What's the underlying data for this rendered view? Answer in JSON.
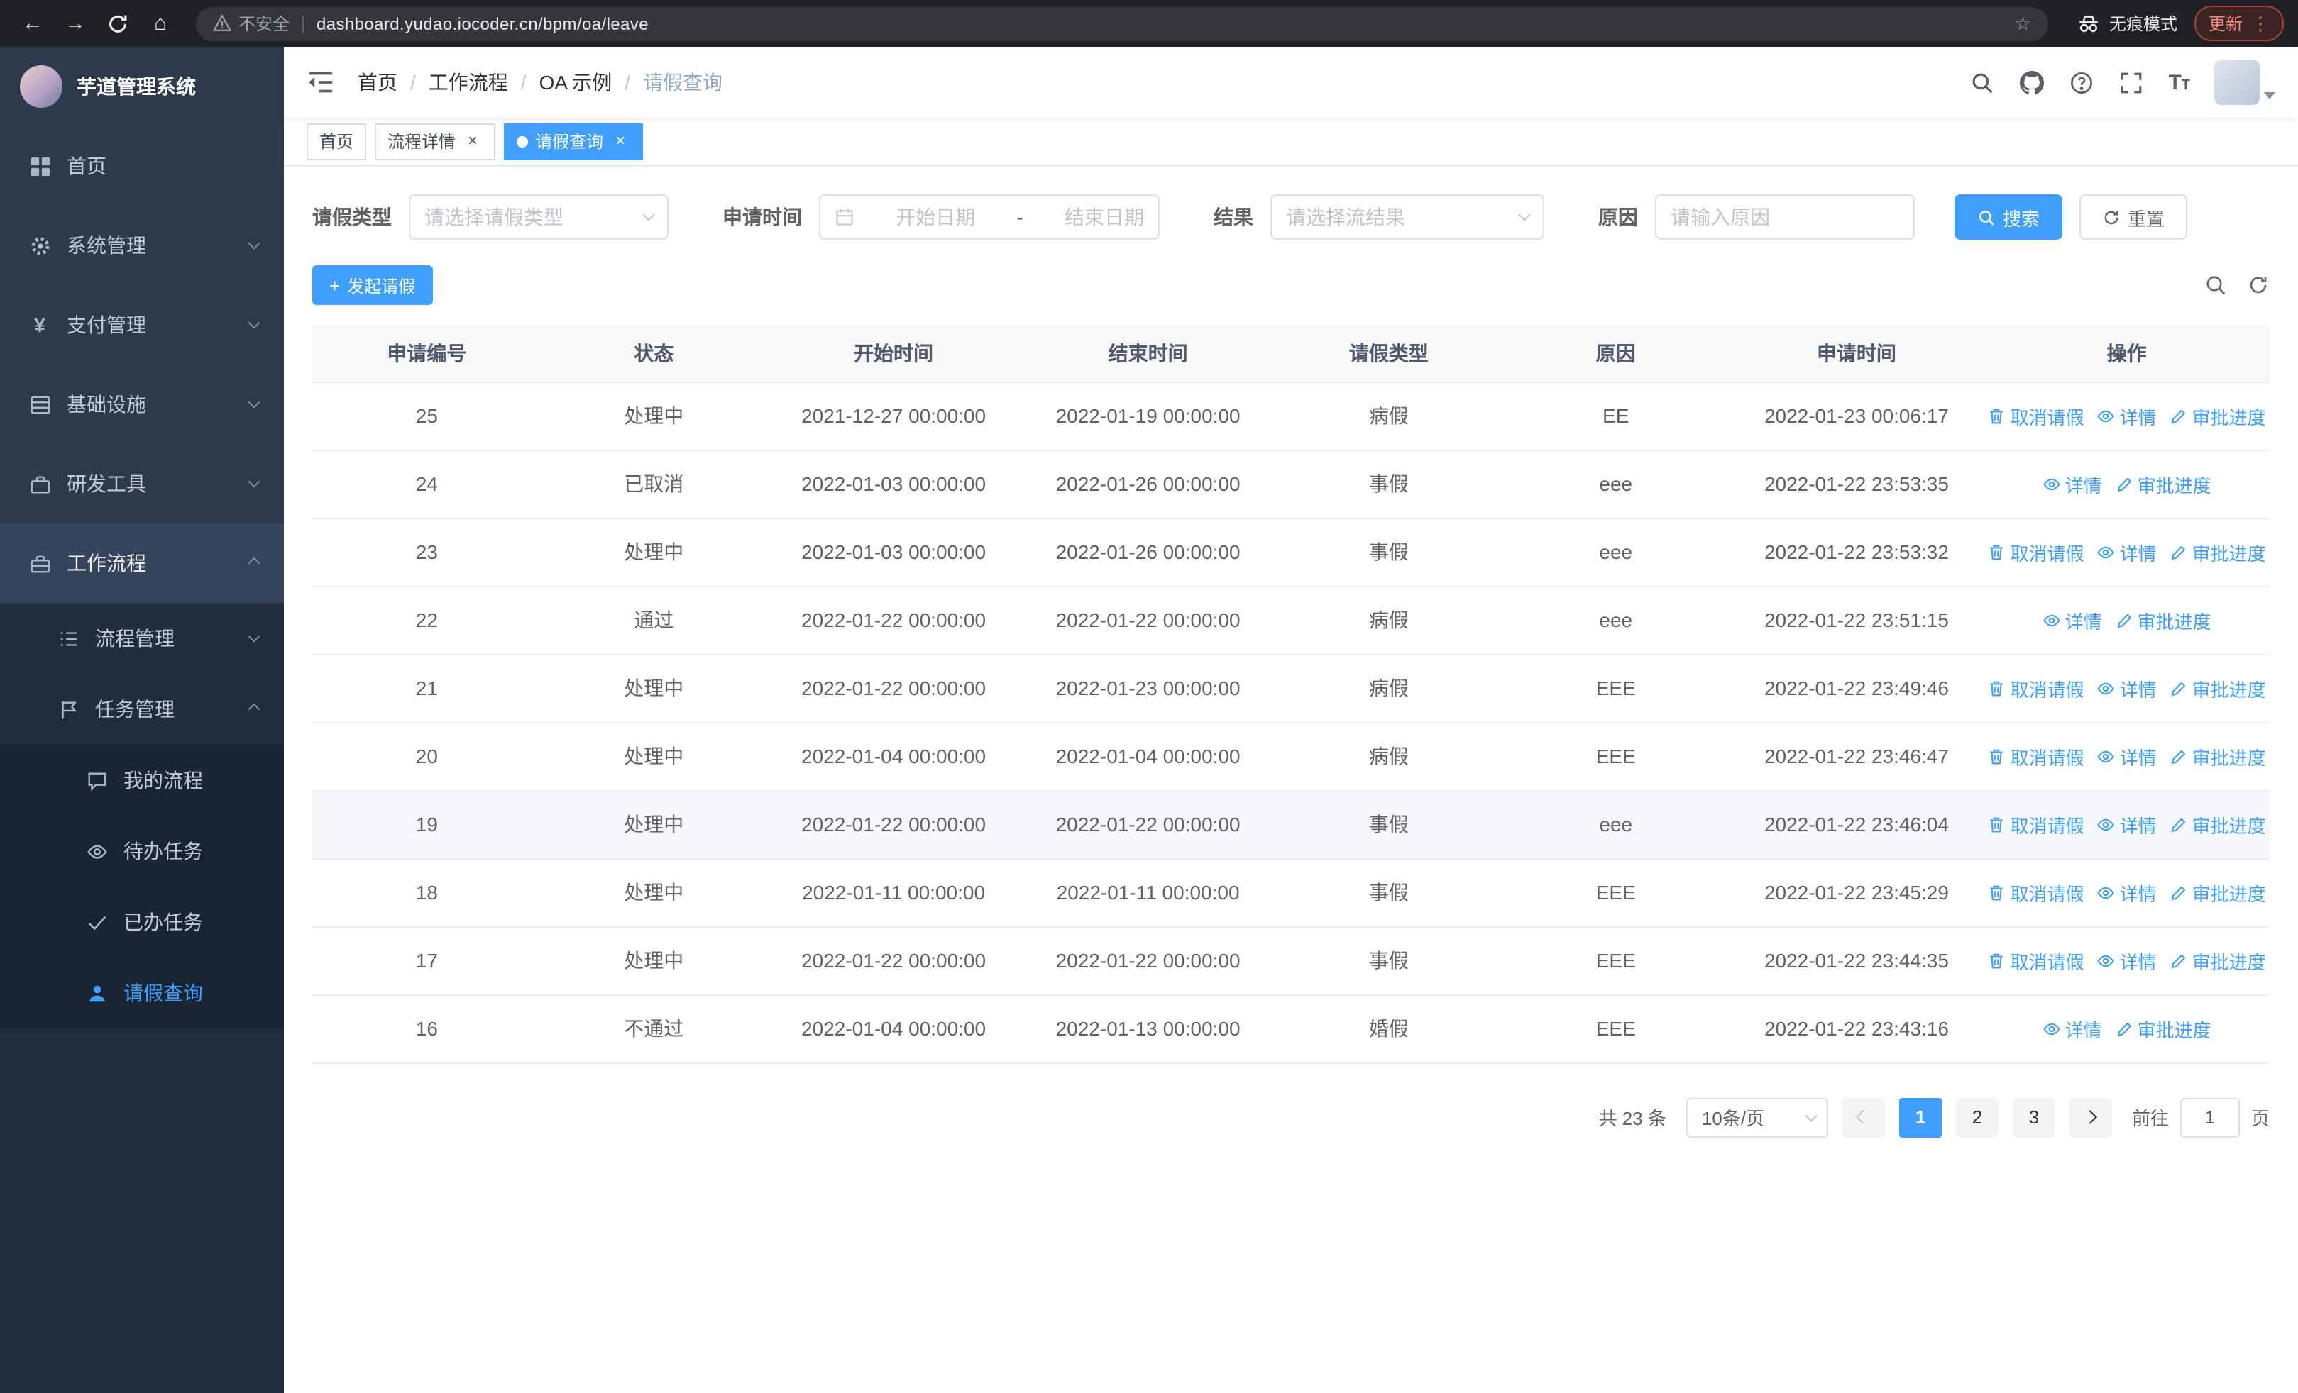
{
  "browser": {
    "security_label": "不安全",
    "url": "dashboard.yudao.iocoder.cn/bpm/oa/leave",
    "incognito_label": "无痕模式",
    "update_button": "更新"
  },
  "sidebar": {
    "app_title": "芋道管理系统",
    "items": [
      {
        "label": "首页"
      },
      {
        "label": "系统管理"
      },
      {
        "label": "支付管理"
      },
      {
        "label": "基础设施"
      },
      {
        "label": "研发工具"
      },
      {
        "label": "工作流程"
      }
    ],
    "workflow_children": [
      {
        "label": "流程管理"
      },
      {
        "label": "任务管理"
      }
    ],
    "task_children": [
      {
        "label": "我的流程"
      },
      {
        "label": "待办任务"
      },
      {
        "label": "已办任务"
      },
      {
        "label": "请假查询"
      }
    ]
  },
  "header": {
    "separator": "/",
    "breadcrumb": [
      {
        "label": "首页"
      },
      {
        "label": "工作流程"
      },
      {
        "label": "OA 示例"
      },
      {
        "label": "请假查询"
      }
    ]
  },
  "tabs": [
    {
      "label": "首页"
    },
    {
      "label": "流程详情"
    },
    {
      "label": "请假查询"
    }
  ],
  "filters": {
    "leave_type": {
      "label": "请假类型",
      "placeholder": "请选择请假类型"
    },
    "apply_time": {
      "label": "申请时间",
      "start_placeholder": "开始日期",
      "separator": "-",
      "end_placeholder": "结束日期"
    },
    "result": {
      "label": "结果",
      "placeholder": "请选择流结果"
    },
    "reason": {
      "label": "原因",
      "placeholder": "请输入原因"
    },
    "search_button": "搜索",
    "reset_button": "重置"
  },
  "toolbar": {
    "create_button": "发起请假"
  },
  "table": {
    "columns": [
      "申请编号",
      "状态",
      "开始时间",
      "结束时间",
      "请假类型",
      "原因",
      "申请时间",
      "操作"
    ],
    "rows": [
      {
        "id": "25",
        "status": "处理中",
        "start": "2021-12-27 00:00:00",
        "end": "2022-01-19 00:00:00",
        "type": "病假",
        "reason": "EE",
        "applied": "2022-01-23 00:06:17",
        "actions": [
          {
            "label": "取消请假",
            "name": "cancel-leave-link",
            "icon": "delete-icon"
          },
          {
            "label": "详情",
            "name": "detail-link",
            "icon": "view-icon"
          },
          {
            "label": "审批进度",
            "name": "progress-link",
            "icon": "edit-icon"
          }
        ]
      },
      {
        "id": "24",
        "status": "已取消",
        "start": "2022-01-03 00:00:00",
        "end": "2022-01-26 00:00:00",
        "type": "事假",
        "reason": "eee",
        "applied": "2022-01-22 23:53:35",
        "actions": [
          {
            "label": "详情",
            "name": "detail-link",
            "icon": "view-icon"
          },
          {
            "label": "审批进度",
            "name": "progress-link",
            "icon": "edit-icon"
          }
        ]
      },
      {
        "id": "23",
        "status": "处理中",
        "start": "2022-01-03 00:00:00",
        "end": "2022-01-26 00:00:00",
        "type": "事假",
        "reason": "eee",
        "applied": "2022-01-22 23:53:32",
        "actions": [
          {
            "label": "取消请假",
            "name": "cancel-leave-link",
            "icon": "delete-icon"
          },
          {
            "label": "详情",
            "name": "detail-link",
            "icon": "view-icon"
          },
          {
            "label": "审批进度",
            "name": "progress-link",
            "icon": "edit-icon"
          }
        ]
      },
      {
        "id": "22",
        "status": "通过",
        "start": "2022-01-22 00:00:00",
        "end": "2022-01-22 00:00:00",
        "type": "病假",
        "reason": "eee",
        "applied": "2022-01-22 23:51:15",
        "actions": [
          {
            "label": "详情",
            "name": "detail-link",
            "icon": "view-icon"
          },
          {
            "label": "审批进度",
            "name": "progress-link",
            "icon": "edit-icon"
          }
        ]
      },
      {
        "id": "21",
        "status": "处理中",
        "start": "2022-01-22 00:00:00",
        "end": "2022-01-23 00:00:00",
        "type": "病假",
        "reason": "EEE",
        "applied": "2022-01-22 23:49:46",
        "actions": [
          {
            "label": "取消请假",
            "name": "cancel-leave-link",
            "icon": "delete-icon"
          },
          {
            "label": "详情",
            "name": "detail-link",
            "icon": "view-icon"
          },
          {
            "label": "审批进度",
            "name": "progress-link",
            "icon": "edit-icon"
          }
        ]
      },
      {
        "id": "20",
        "status": "处理中",
        "start": "2022-01-04 00:00:00",
        "end": "2022-01-04 00:00:00",
        "type": "病假",
        "reason": "EEE",
        "applied": "2022-01-22 23:46:47",
        "actions": [
          {
            "label": "取消请假",
            "name": "cancel-leave-link",
            "icon": "delete-icon"
          },
          {
            "label": "详情",
            "name": "detail-link",
            "icon": "view-icon"
          },
          {
            "label": "审批进度",
            "name": "progress-link",
            "icon": "edit-icon"
          }
        ]
      },
      {
        "id": "19",
        "status": "处理中",
        "start": "2022-01-22 00:00:00",
        "end": "2022-01-22 00:00:00",
        "type": "事假",
        "reason": "eee",
        "applied": "2022-01-22 23:46:04",
        "highlighted": true,
        "actions": [
          {
            "label": "取消请假",
            "name": "cancel-leave-link",
            "icon": "delete-icon"
          },
          {
            "label": "详情",
            "name": "detail-link",
            "icon": "view-icon"
          },
          {
            "label": "审批进度",
            "name": "progress-link",
            "icon": "edit-icon"
          }
        ]
      },
      {
        "id": "18",
        "status": "处理中",
        "start": "2022-01-11 00:00:00",
        "end": "2022-01-11 00:00:00",
        "type": "事假",
        "reason": "EEE",
        "applied": "2022-01-22 23:45:29",
        "actions": [
          {
            "label": "取消请假",
            "name": "cancel-leave-link",
            "icon": "delete-icon"
          },
          {
            "label": "详情",
            "name": "detail-link",
            "icon": "view-icon"
          },
          {
            "label": "审批进度",
            "name": "progress-link",
            "icon": "edit-icon"
          }
        ]
      },
      {
        "id": "17",
        "status": "处理中",
        "start": "2022-01-22 00:00:00",
        "end": "2022-01-22 00:00:00",
        "type": "事假",
        "reason": "EEE",
        "applied": "2022-01-22 23:44:35",
        "actions": [
          {
            "label": "取消请假",
            "name": "cancel-leave-link",
            "icon": "delete-icon"
          },
          {
            "label": "详情",
            "name": "detail-link",
            "icon": "view-icon"
          },
          {
            "label": "审批进度",
            "name": "progress-link",
            "icon": "edit-icon"
          }
        ]
      },
      {
        "id": "16",
        "status": "不通过",
        "start": "2022-01-04 00:00:00",
        "end": "2022-01-13 00:00:00",
        "type": "婚假",
        "reason": "EEE",
        "applied": "2022-01-22 23:43:16",
        "actions": [
          {
            "label": "详情",
            "name": "detail-link",
            "icon": "view-icon"
          },
          {
            "label": "审批进度",
            "name": "progress-link",
            "icon": "edit-icon"
          }
        ]
      }
    ]
  },
  "pagination": {
    "total": "共 23 条",
    "page_size": "10条/页",
    "pages": [
      "1",
      "2",
      "3"
    ],
    "goto_label": "前往",
    "goto_value": "1",
    "unit_label": "页"
  },
  "colors": {
    "primary": "#409eff",
    "sidebar_bg": "#2d3a4b",
    "chrome_bg": "#202124",
    "update_badge": "#f28b82",
    "table_border": "#ebeef5"
  }
}
